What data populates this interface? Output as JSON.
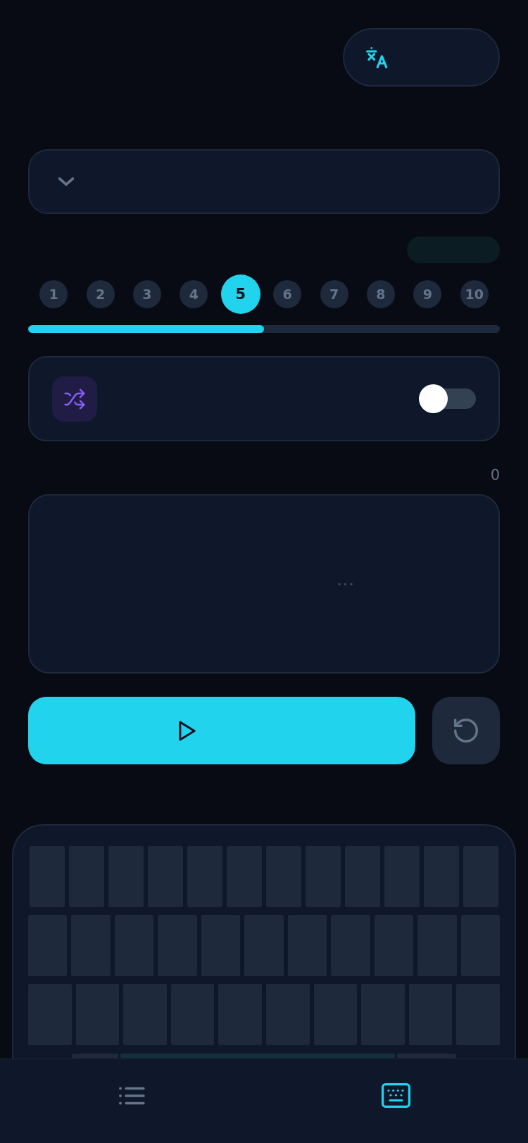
{
  "steps": [
    {
      "label": "1",
      "selected": false
    },
    {
      "label": "2",
      "selected": false
    },
    {
      "label": "3",
      "selected": false
    },
    {
      "label": "4",
      "selected": false
    },
    {
      "label": "5",
      "selected": true
    },
    {
      "label": "6",
      "selected": false
    },
    {
      "label": "7",
      "selected": false
    },
    {
      "label": "8",
      "selected": false
    },
    {
      "label": "9",
      "selected": false
    },
    {
      "label": "10",
      "selected": false
    }
  ],
  "progress": {
    "level": 0.5
  },
  "shuffle": {
    "on": false
  },
  "counter": "0",
  "bottom_nav": [
    {
      "selected": false
    },
    {
      "selected": true
    }
  ]
}
